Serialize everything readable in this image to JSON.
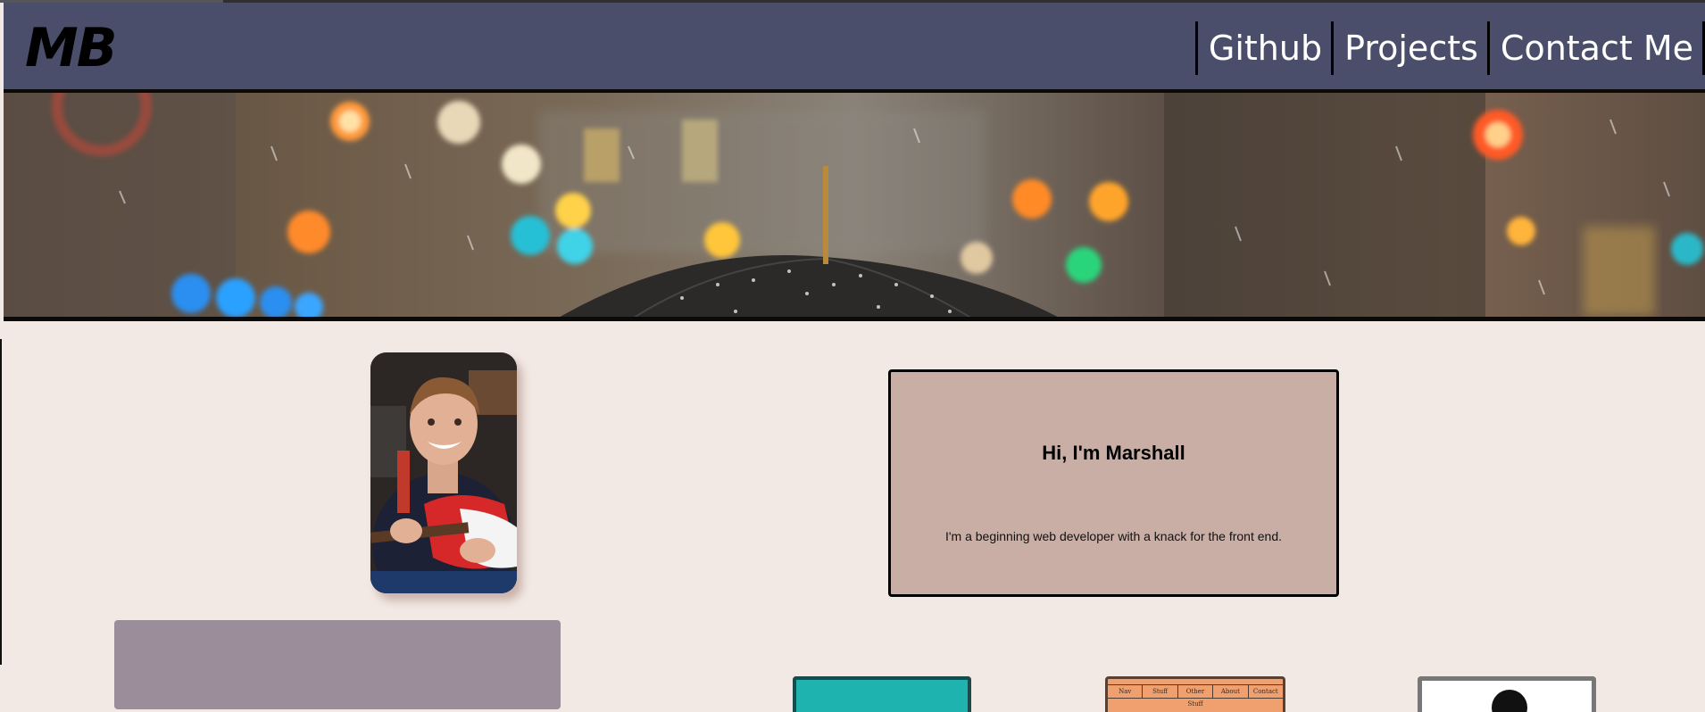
{
  "header": {
    "logo": "MB",
    "nav": [
      {
        "label": "Github"
      },
      {
        "label": "Projects"
      },
      {
        "label": "Contact Me"
      }
    ]
  },
  "banner": {
    "image": "rainy-city-umbrella-banner"
  },
  "profile": {
    "image": "marshall-with-guitar-photo"
  },
  "intro": {
    "title": "Hi, I'm Marshall",
    "text": "I'm a beginning web developer with a knack for the front end."
  },
  "projects": {
    "mini_nav": [
      "Nav",
      "Stuff",
      "Other Stuff",
      "About",
      "Contact"
    ]
  },
  "colors": {
    "navbar": "#4b4e6b",
    "page_background": "#f3e9e4",
    "intro_card": "#c9aea6",
    "grey_box": "#9b8d9a",
    "nav_text": "#ffffff"
  }
}
